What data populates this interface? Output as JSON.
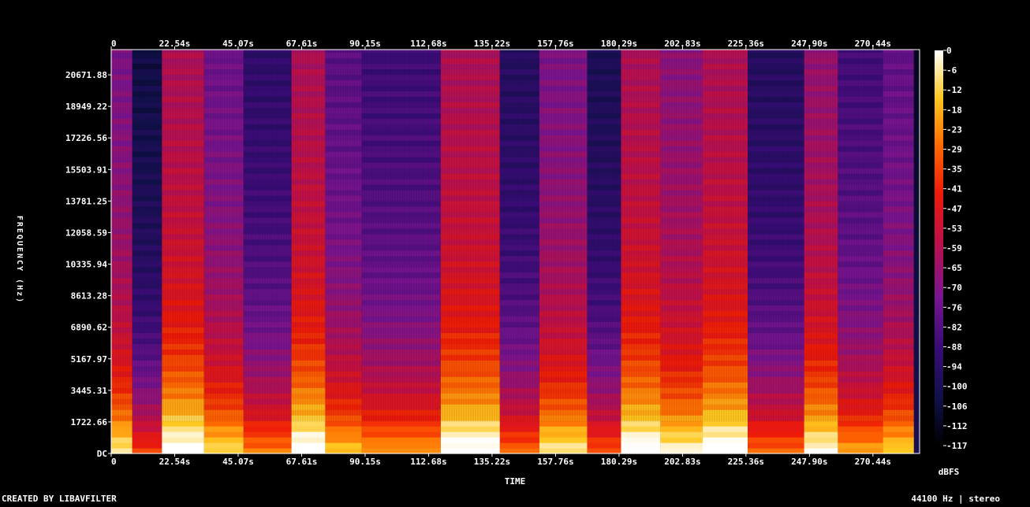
{
  "chart_data": {
    "type": "heatmap",
    "title": "",
    "xlabel": "TIME",
    "ylabel": "FREQUENCY (Hz)",
    "x_ticks": [
      "0",
      "22.54s",
      "45.07s",
      "67.61s",
      "90.15s",
      "112.68s",
      "135.22s",
      "157.76s",
      "180.29s",
      "202.83s",
      "225.36s",
      "247.90s",
      "270.44s"
    ],
    "x_tick_values": [
      0,
      22.54,
      45.07,
      67.61,
      90.15,
      112.68,
      135.22,
      157.76,
      180.29,
      202.83,
      225.36,
      247.9,
      270.44
    ],
    "x_range": [
      0,
      287
    ],
    "y_ticks": [
      "DC",
      "1722.66",
      "3445.31",
      "5167.97",
      "6890.62",
      "8613.28",
      "10335.94",
      "12058.59",
      "13781.25",
      "15503.91",
      "17226.56",
      "18949.22",
      "20671.88"
    ],
    "y_tick_values": [
      0,
      1722.66,
      3445.31,
      5167.97,
      6890.62,
      8613.28,
      10335.94,
      12058.59,
      13781.25,
      15503.91,
      17226.56,
      18949.22,
      20671.88
    ],
    "y_range": [
      0,
      22050
    ],
    "colorbar": {
      "label": "dBFS",
      "ticks": [
        "0",
        "-6",
        "-12",
        "-18",
        "-23",
        "-29",
        "-35",
        "-41",
        "-47",
        "-53",
        "-59",
        "-65",
        "-70",
        "-76",
        "-82",
        "-88",
        "-94",
        "-100",
        "-106",
        "-112",
        "-117"
      ],
      "range": [
        -120,
        0
      ]
    },
    "segments": [
      {
        "x": [
          0,
          7.5
        ],
        "level": 0.45
      },
      {
        "x": [
          7.5,
          18
        ],
        "level": 0.18
      },
      {
        "x": [
          18,
          33
        ],
        "level": 0.55
      },
      {
        "x": [
          33,
          47
        ],
        "level": 0.42
      },
      {
        "x": [
          47,
          64
        ],
        "level": 0.28
      },
      {
        "x": [
          64,
          76
        ],
        "level": 0.55
      },
      {
        "x": [
          76,
          89
        ],
        "level": 0.38
      },
      {
        "x": [
          89,
          117
        ],
        "level": 0.32
      },
      {
        "x": [
          117,
          138
        ],
        "level": 0.55
      },
      {
        "x": [
          138,
          152
        ],
        "level": 0.25
      },
      {
        "x": [
          152,
          169
        ],
        "level": 0.45
      },
      {
        "x": [
          169,
          181
        ],
        "level": 0.22
      },
      {
        "x": [
          181,
          195
        ],
        "level": 0.55
      },
      {
        "x": [
          195,
          210
        ],
        "level": 0.48
      },
      {
        "x": [
          210,
          226
        ],
        "level": 0.55
      },
      {
        "x": [
          226,
          246
        ],
        "level": 0.25
      },
      {
        "x": [
          246,
          258
        ],
        "level": 0.5
      },
      {
        "x": [
          258,
          274
        ],
        "level": 0.33
      },
      {
        "x": [
          274,
          285
        ],
        "level": 0.4
      },
      {
        "x": [
          285,
          287
        ],
        "level": 0.05
      }
    ]
  },
  "footer": {
    "left": "CREATED BY LIBAVFILTER",
    "right": "44100 Hz | stereo"
  }
}
